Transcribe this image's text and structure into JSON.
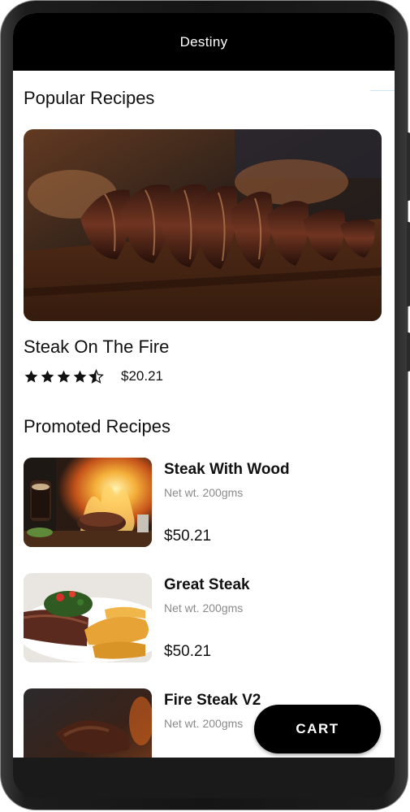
{
  "appbar": {
    "title": "Destiny"
  },
  "popular": {
    "section_title": "Popular Recipes",
    "recipe": {
      "name": "Steak On The Fire",
      "rating": 4.5,
      "rating_max": 5,
      "price": "$20.21"
    }
  },
  "promoted": {
    "section_title": "Promoted Recipes",
    "items": [
      {
        "name": "Steak With Wood",
        "weight": "Net wt. 200gms",
        "price": "$50.21"
      },
      {
        "name": "Great Steak",
        "weight": "Net wt. 200gms",
        "price": "$50.21"
      },
      {
        "name": "Fire Steak V2",
        "weight": "Net wt. 200gms",
        "price": ""
      }
    ]
  },
  "cart": {
    "label": "CART"
  },
  "colors": {
    "appbar_bg": "#000000",
    "cart_bg": "#000000",
    "text_primary": "#111111",
    "text_secondary": "#8a8a8a"
  }
}
